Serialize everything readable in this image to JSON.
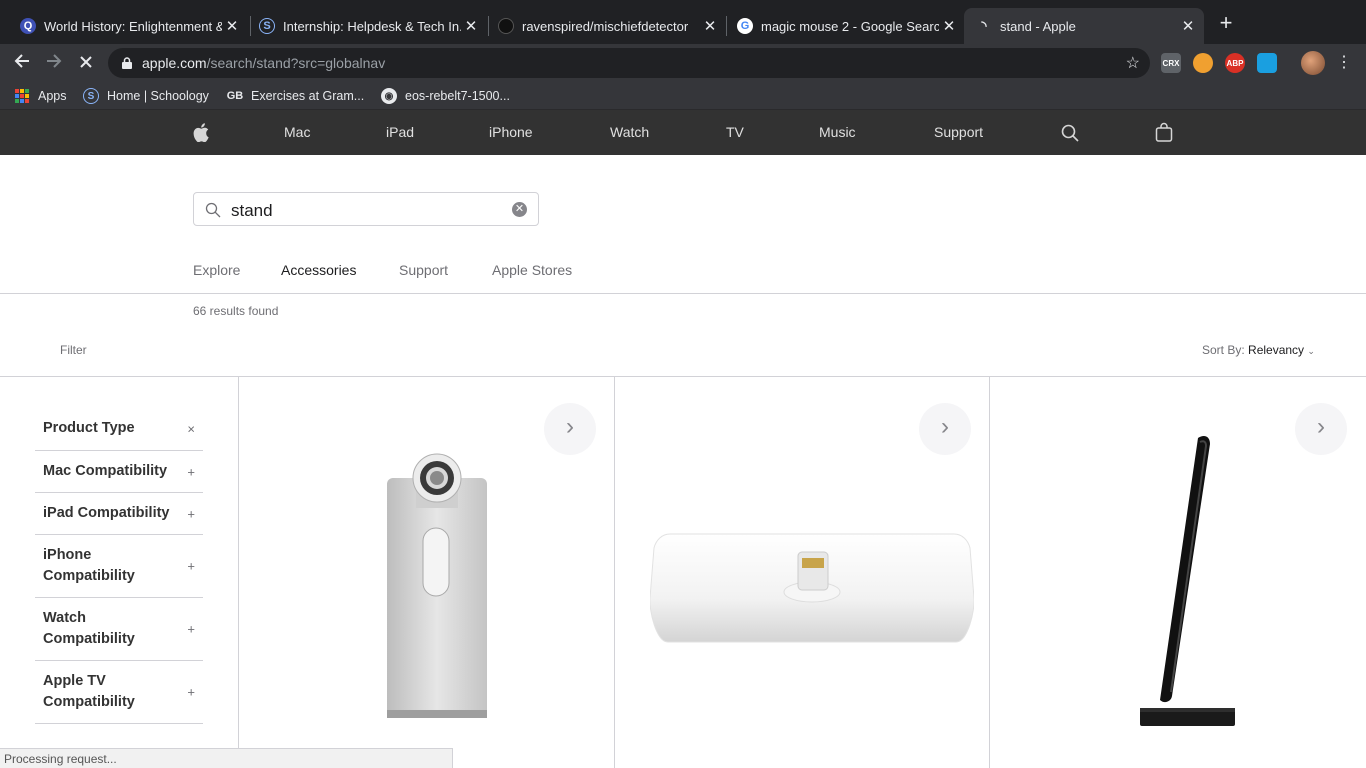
{
  "tabs": [
    {
      "title": "World History: Enlightenment & ...",
      "favicon": "Q",
      "favicon_color": "#4f5bd5"
    },
    {
      "title": "Internship: Helpdesk & Tech In...",
      "favicon": "S",
      "favicon_color": "#2a7bbf"
    },
    {
      "title": "ravenspired/mischiefdetector",
      "favicon": "",
      "favicon_color": "#e8eaed"
    },
    {
      "title": "magic mouse 2 - Google Search",
      "favicon": "G",
      "favicon_color": "#ffffff"
    },
    {
      "title": "stand - Apple",
      "favicon": "",
      "favicon_color": "#e8eaed",
      "active": true
    }
  ],
  "toolbar": {
    "url_host": "apple.com",
    "url_path": "/search/stand?src=globalnav",
    "extensions": [
      "CRX",
      "",
      "ABP",
      ""
    ]
  },
  "bookmarks": [
    {
      "label": "Apps"
    },
    {
      "label": "Home | Schoology"
    },
    {
      "label": "Exercises at Gram..."
    },
    {
      "label": "eos-rebelt7-1500..."
    }
  ],
  "apple_nav": {
    "items": [
      "Mac",
      "iPad",
      "iPhone",
      "Watch",
      "TV",
      "Music",
      "Support"
    ]
  },
  "search": {
    "query": "stand",
    "tabs": [
      "Explore",
      "Accessories",
      "Support",
      "Apple Stores"
    ],
    "active_tab": "Accessories",
    "results_count": "66 results found",
    "filter_label": "Filter",
    "sort_label": "Sort By:",
    "sort_value": "Relevancy"
  },
  "filters": [
    {
      "label": "Product Type",
      "sign": "×"
    },
    {
      "label": "Mac Compatibility",
      "sign": "+"
    },
    {
      "label": "iPad Compatibility",
      "sign": "+"
    },
    {
      "label": "iPhone Compatibility",
      "sign": "+"
    },
    {
      "label": "Watch Compatibility",
      "sign": "+"
    },
    {
      "label": "Apple TV Compatibility",
      "sign": "+"
    }
  ],
  "status_bar": "Processing request...",
  "colors": {
    "tab_bg": "#202124",
    "toolbar_bg": "#35363a",
    "apple_nav_bg": "#323232",
    "page_bg": "#ffffff"
  }
}
